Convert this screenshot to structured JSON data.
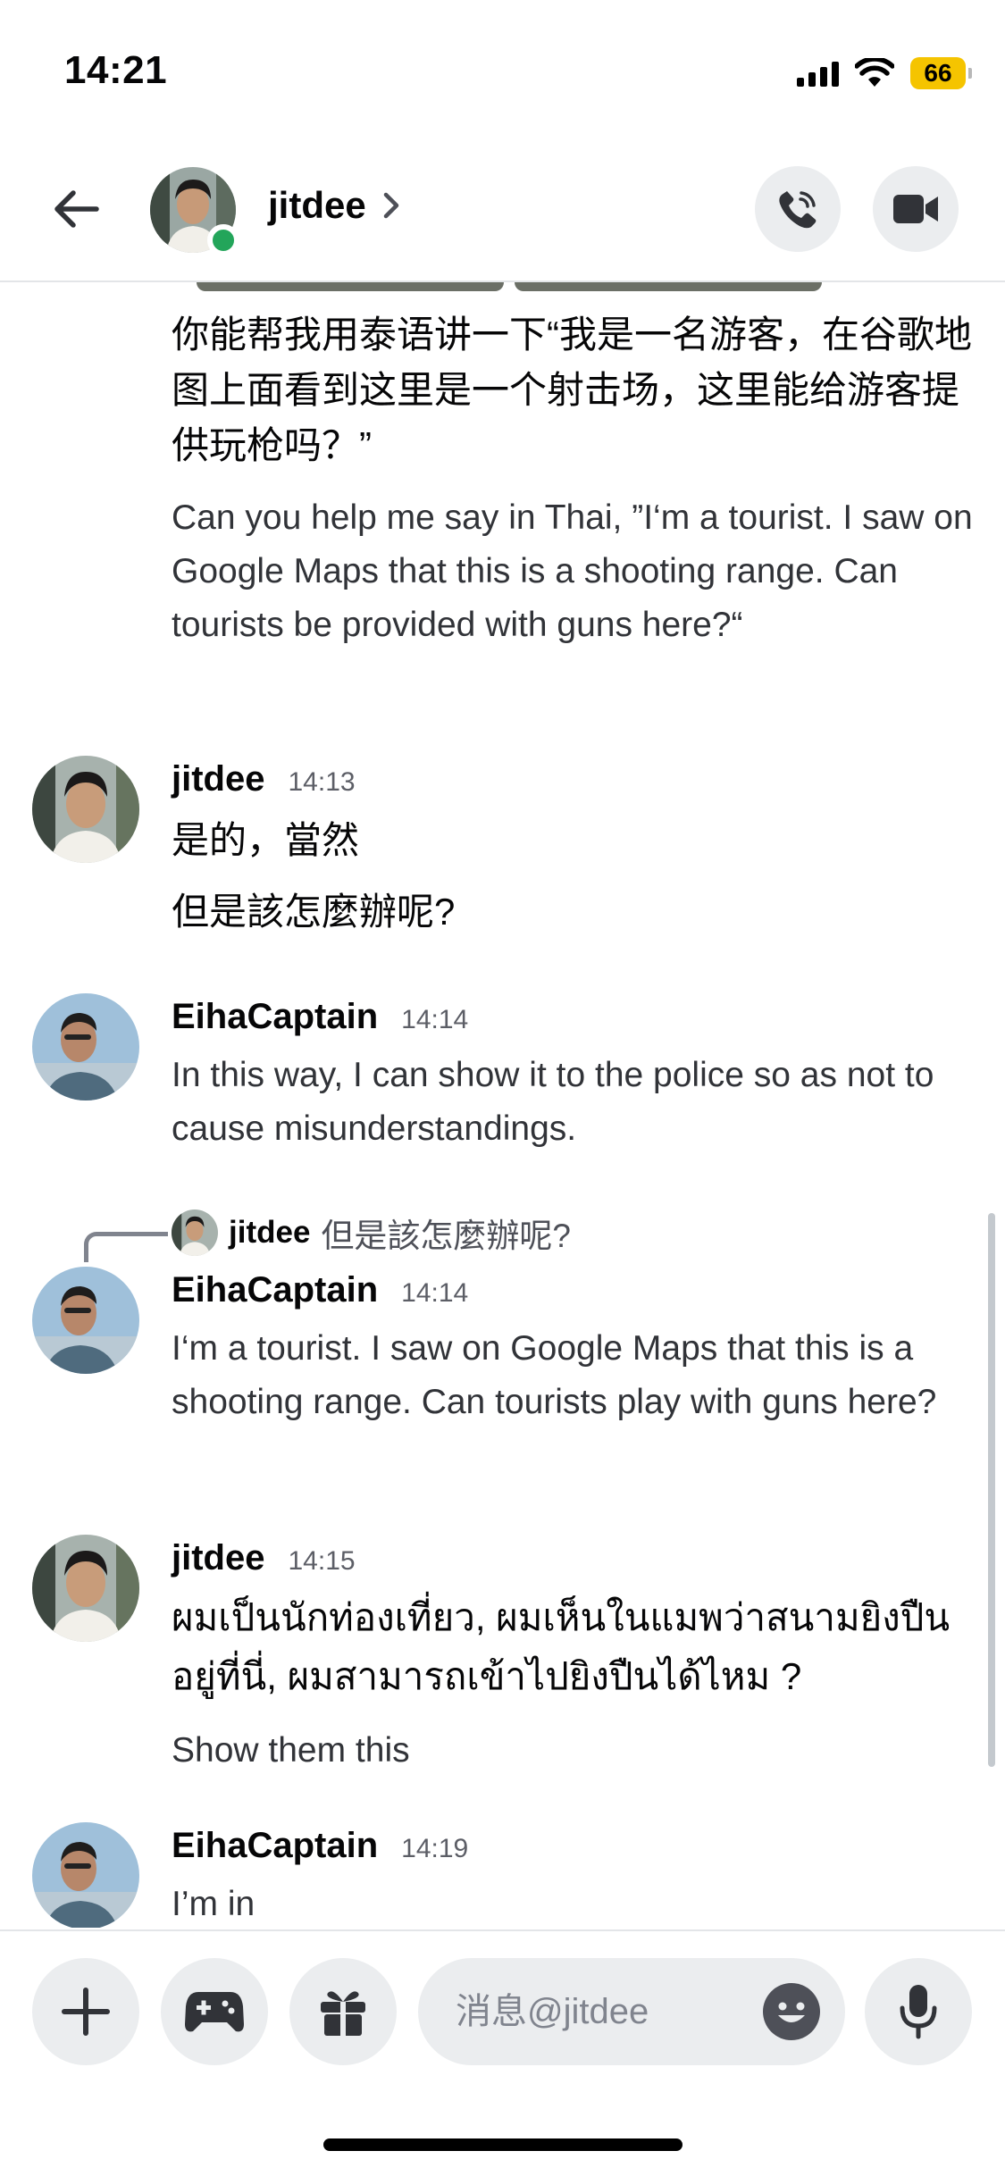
{
  "status_bar": {
    "time": "14:21",
    "battery": "66",
    "battery_color": "#f5c400",
    "icons": [
      "cellular-signal-icon",
      "wifi-icon",
      "battery-icon"
    ]
  },
  "header": {
    "name": "jitdee",
    "chevron": "›",
    "online_color": "#23a55a",
    "icons": [
      "back-arrow-icon",
      "phone-call-icon",
      "video-camera-icon"
    ]
  },
  "messages": [
    {
      "continued": true,
      "lines": [
        "你能帮我用泰语讲一下“我是一名游客，在谷歌地图上面看到这里是一个射击场，这里能给游客提供玩枪吗？”",
        "Can you help me say in Thai, ”I‘m a tourist. I saw on Google Maps that this is a shooting range. Can tourists be provided with guns here?“"
      ]
    },
    {
      "author": "jitdee",
      "time": "14:13",
      "lines": [
        "是的，當然",
        "但是該怎麼辦呢?"
      ]
    },
    {
      "author": "EihaCaptain",
      "time": "14:14",
      "lines": [
        "In this way, I can show it to the police so as not to cause misunderstandings."
      ]
    },
    {
      "author": "EihaCaptain",
      "time": "14:14",
      "reply_to": {
        "author": "jitdee",
        "text": "但是該怎麼辦呢?"
      },
      "lines": [
        "I‘m a tourist. I saw on Google Maps that this is a shooting range. Can tourists play with guns here?"
      ]
    },
    {
      "author": "jitdee",
      "time": "14:15",
      "lines": [
        "ผมเป็นนักท่องเที่ยว, ผมเห็นในแมพว่าสนามยิงปืนอยู่ที่นี่, ผมสามารถเข้าไปยิงปืนได้ไหม ?",
        "Show them this"
      ]
    },
    {
      "author": "EihaCaptain",
      "time": "14:19",
      "lines": [
        "I’m in"
      ]
    }
  ],
  "composer": {
    "placeholder": "消息@jitdee",
    "icons": [
      "plus-icon",
      "gamepad-icon",
      "gift-icon",
      "emoji-icon",
      "microphone-icon"
    ]
  }
}
